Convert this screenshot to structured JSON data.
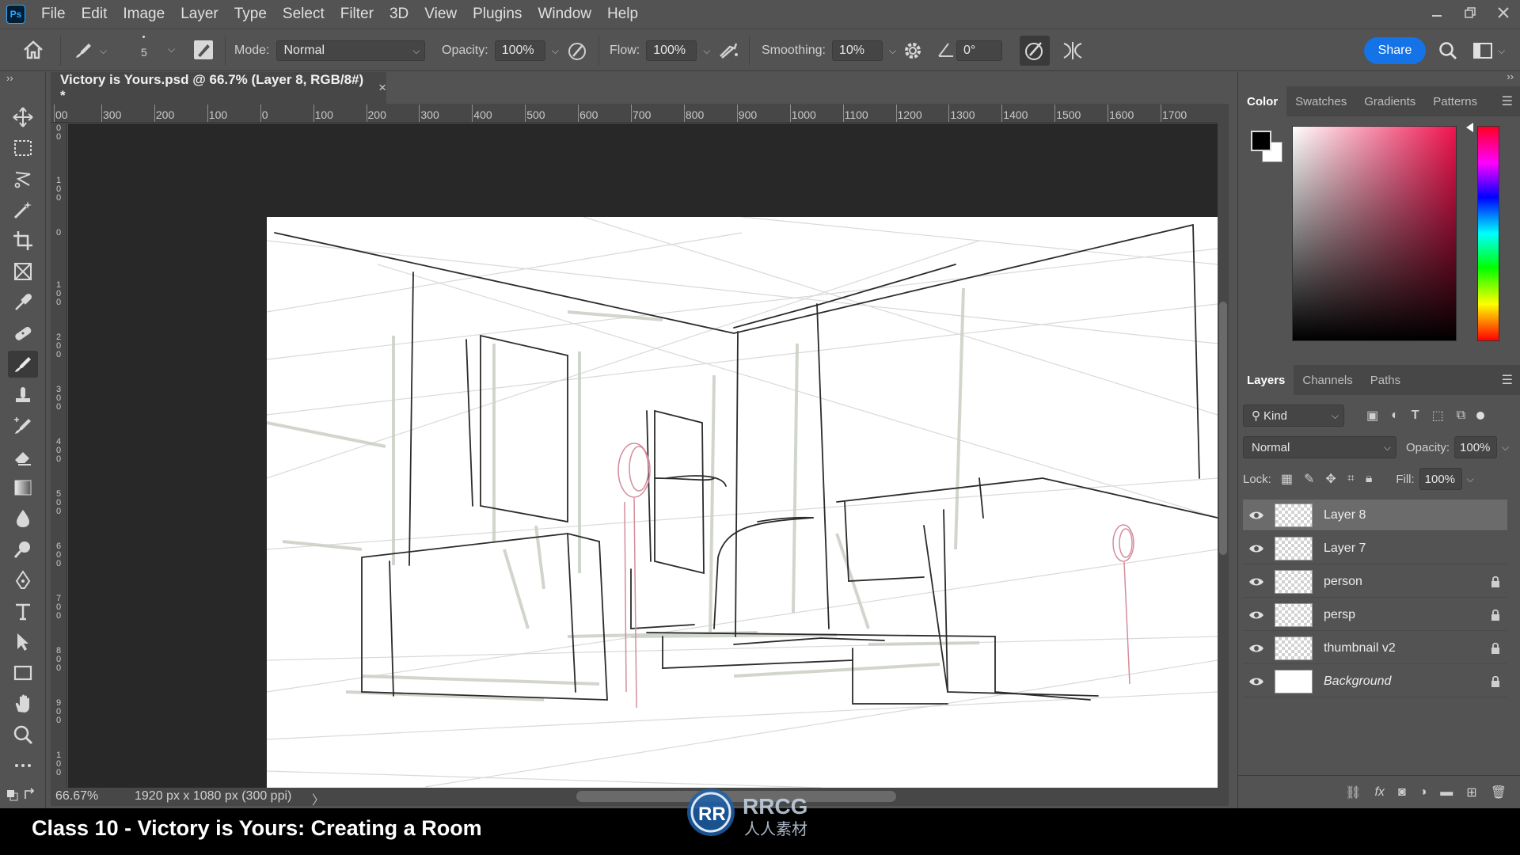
{
  "app": {
    "logo_text": "Ps"
  },
  "menu": [
    "File",
    "Edit",
    "Image",
    "Layer",
    "Type",
    "Select",
    "Filter",
    "3D",
    "View",
    "Plugins",
    "Window",
    "Help"
  ],
  "options": {
    "brush_size": "5",
    "mode_label": "Mode:",
    "mode_value": "Normal",
    "opacity_label": "Opacity:",
    "opacity_value": "100%",
    "flow_label": "Flow:",
    "flow_value": "100%",
    "smoothing_label": "Smoothing:",
    "smoothing_value": "10%",
    "angle_value": "0°",
    "share_label": "Share"
  },
  "document": {
    "tab_title": "Victory is Yours.psd @ 66.7% (Layer 8, RGB/8#) *",
    "close_glyph": "×",
    "zoom": "66.67%",
    "info": "1920 px x 1080 px (300 ppi)",
    "status_arrow": "〉"
  },
  "ruler": {
    "h_ticks": [
      "00",
      "300",
      "200",
      "100",
      "0",
      "100",
      "200",
      "300",
      "400",
      "500",
      "600",
      "700",
      "800",
      "900",
      "1000",
      "1100",
      "1200",
      "1300",
      "1400",
      "1500",
      "1600",
      "1700"
    ],
    "v_ticks": [
      "0\n0",
      "1\n0\n0",
      "0",
      "1\n0\n0",
      "2\n0\n0",
      "3\n0\n0",
      "4\n0\n0",
      "5\n0\n0",
      "6\n0\n0",
      "7\n0\n0",
      "8\n0\n0",
      "9\n0\n0",
      "1\n0\n0"
    ]
  },
  "color_panel": {
    "tabs": [
      "Color",
      "Swatches",
      "Gradients",
      "Patterns"
    ],
    "foreground": "#000000",
    "background": "#ffffff"
  },
  "layers_panel": {
    "tabs": [
      "Layers",
      "Channels",
      "Paths"
    ],
    "filter_label": "Kind",
    "blend_mode": "Normal",
    "opacity_label": "Opacity:",
    "opacity_value": "100%",
    "lock_label": "Lock:",
    "fill_label": "Fill:",
    "fill_value": "100%",
    "layers": [
      {
        "name": "Layer 8",
        "selected": true,
        "locked": false
      },
      {
        "name": "Layer 7",
        "selected": false,
        "locked": false
      },
      {
        "name": "person",
        "selected": false,
        "locked": true
      },
      {
        "name": "persp",
        "selected": false,
        "locked": true
      },
      {
        "name": "thumbnail v2",
        "selected": false,
        "locked": true
      },
      {
        "name": "Background",
        "selected": false,
        "locked": true
      }
    ]
  },
  "caption": "Class 10 - Victory is Yours: Creating a Room",
  "watermark": {
    "brand": "RRCG",
    "sub": "人人素材"
  },
  "colors": {
    "accent": "#1473e6",
    "panel": "#535353",
    "dark": "#474747",
    "pasteboard": "#282828"
  }
}
